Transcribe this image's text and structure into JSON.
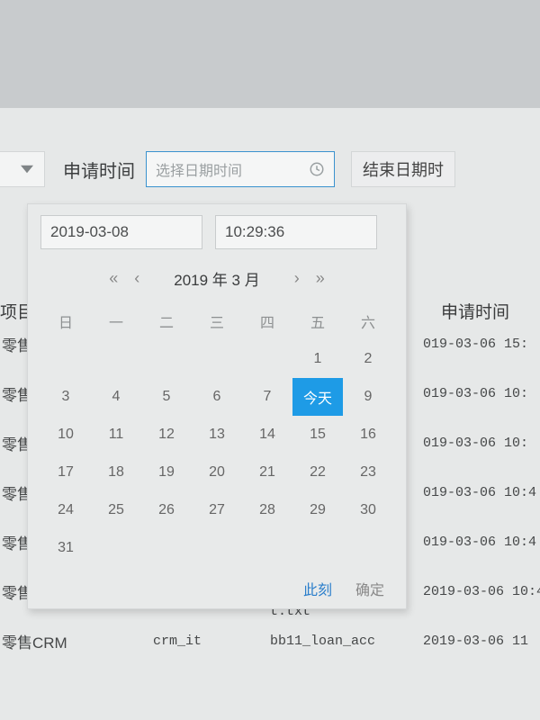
{
  "filter": {
    "dropdown_placeholder": "",
    "label": "申请时间",
    "datetime_placeholder": "选择日期时间",
    "end_label": "结束日期时"
  },
  "picker": {
    "date_value": "2019-03-08",
    "time_value": "10:29:36",
    "nav": {
      "prev_year": "«",
      "prev_month": "‹",
      "title": "2019 年 3 月",
      "next_month": "›",
      "next_year": "»"
    },
    "weekdays": [
      "日",
      "一",
      "二",
      "三",
      "四",
      "五",
      "六"
    ],
    "weeks": [
      [
        {
          "n": ""
        },
        {
          "n": ""
        },
        {
          "n": ""
        },
        {
          "n": ""
        },
        {
          "n": ""
        },
        {
          "n": "1"
        },
        {
          "n": "2"
        }
      ],
      [
        {
          "n": "3"
        },
        {
          "n": "4"
        },
        {
          "n": "5"
        },
        {
          "n": "6"
        },
        {
          "n": "7"
        },
        {
          "n": "今天",
          "today": true
        },
        {
          "n": "9"
        }
      ],
      [
        {
          "n": "10"
        },
        {
          "n": "11"
        },
        {
          "n": "12"
        },
        {
          "n": "13"
        },
        {
          "n": "14"
        },
        {
          "n": "15"
        },
        {
          "n": "16"
        }
      ],
      [
        {
          "n": "17"
        },
        {
          "n": "18"
        },
        {
          "n": "19"
        },
        {
          "n": "20"
        },
        {
          "n": "21"
        },
        {
          "n": "22"
        },
        {
          "n": "23"
        }
      ],
      [
        {
          "n": "24"
        },
        {
          "n": "25"
        },
        {
          "n": "26"
        },
        {
          "n": "27"
        },
        {
          "n": "28"
        },
        {
          "n": "29"
        },
        {
          "n": "30"
        }
      ],
      [
        {
          "n": "31"
        },
        {
          "n": ""
        },
        {
          "n": ""
        },
        {
          "n": ""
        },
        {
          "n": ""
        },
        {
          "n": ""
        },
        {
          "n": ""
        }
      ]
    ],
    "footer": {
      "now": "此刻",
      "ok": "确定"
    }
  },
  "table_header": {
    "project": "项目组",
    "applied": "申请时间"
  },
  "rows": [
    {
      "project": "零售",
      "user": "",
      "file": "",
      "time": "019-03-06 15:"
    },
    {
      "project": "零售",
      "user": "",
      "file": "",
      "time": "019-03-06 10:"
    },
    {
      "project": "零售",
      "user": "",
      "file": "",
      "time": "019-03-06 10:"
    },
    {
      "project": "零售",
      "user": "",
      "file": "",
      "time": "019-03-06 10:4"
    },
    {
      "project": "零售",
      "user": "",
      "file": "t.txt",
      "time": "019-03-06 10:4"
    },
    {
      "project": "零售CRM",
      "user": "crm_it",
      "file": "bb11_loan_acc",
      "file2": "t.txt",
      "time": "2019-03-06 10:4"
    },
    {
      "project": "零售CRM",
      "user": "crm_it",
      "file": "bb11_loan_acc",
      "time": "2019-03-06 11"
    }
  ]
}
